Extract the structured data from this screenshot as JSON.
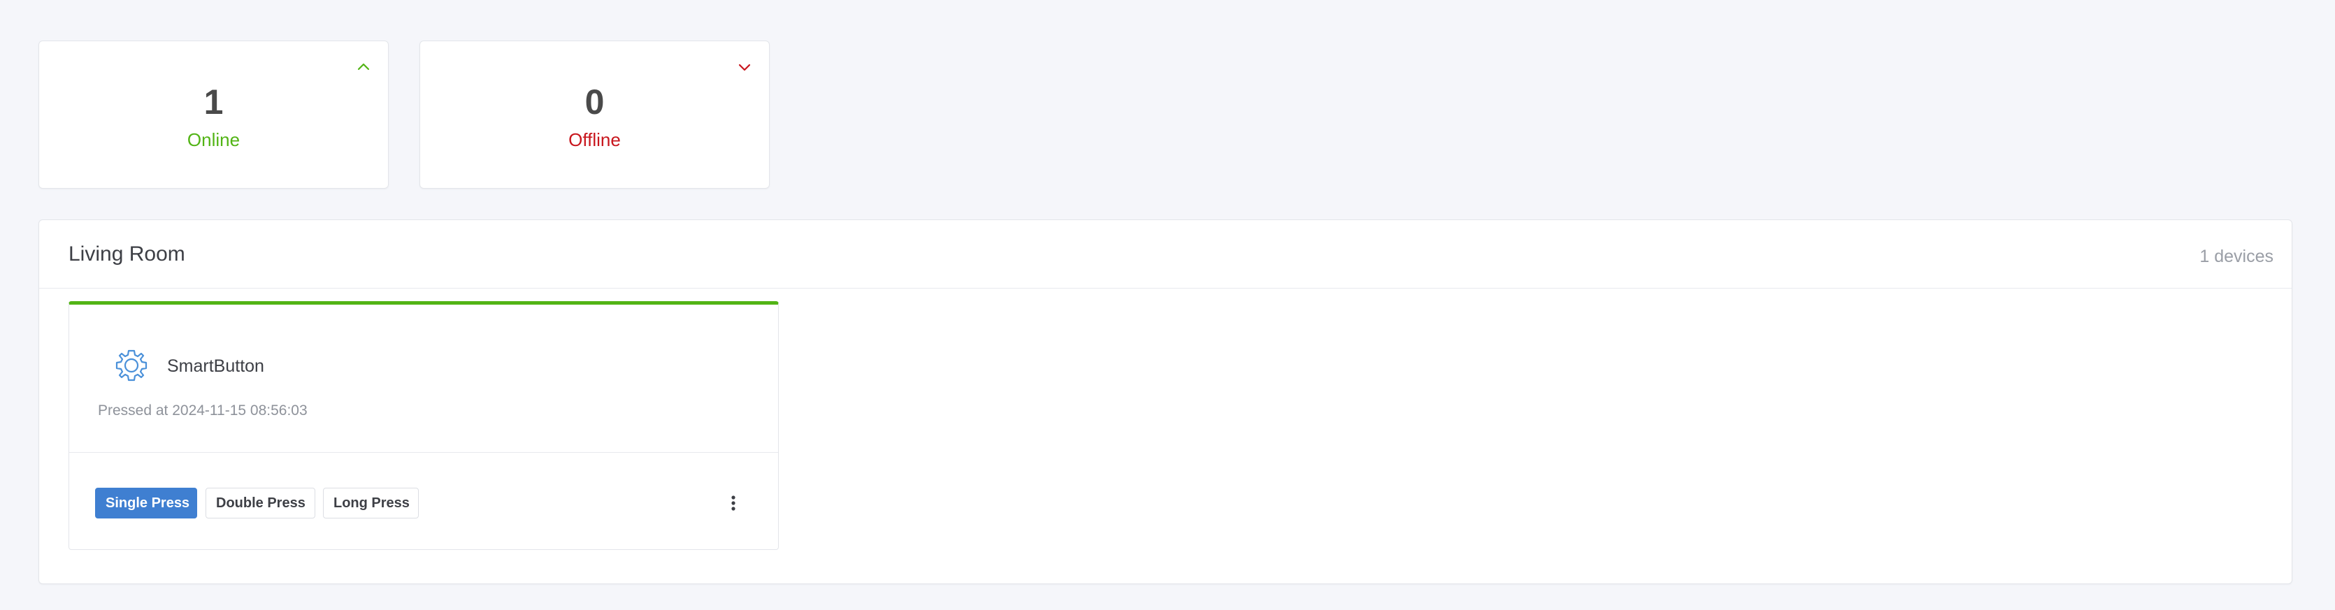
{
  "stats": {
    "online": {
      "value": "1",
      "label": "Online",
      "icon": "chevron-up-icon",
      "color": "#52b415"
    },
    "offline": {
      "value": "0",
      "label": "Offline",
      "icon": "chevron-down-icon",
      "color": "#c8161d"
    }
  },
  "room": {
    "title": "Living Room",
    "device_count": "1 devices",
    "devices": [
      {
        "name": "SmartButton",
        "icon": "gear-icon",
        "status": "online",
        "pressed_text": "Pressed at 2024-11-15 08:56:03",
        "actions": [
          {
            "label": "Single Press",
            "active": true
          },
          {
            "label": "Double Press",
            "active": false
          },
          {
            "label": "Long Press",
            "active": false
          }
        ],
        "menu_icon": "more-vertical-icon"
      }
    ]
  }
}
